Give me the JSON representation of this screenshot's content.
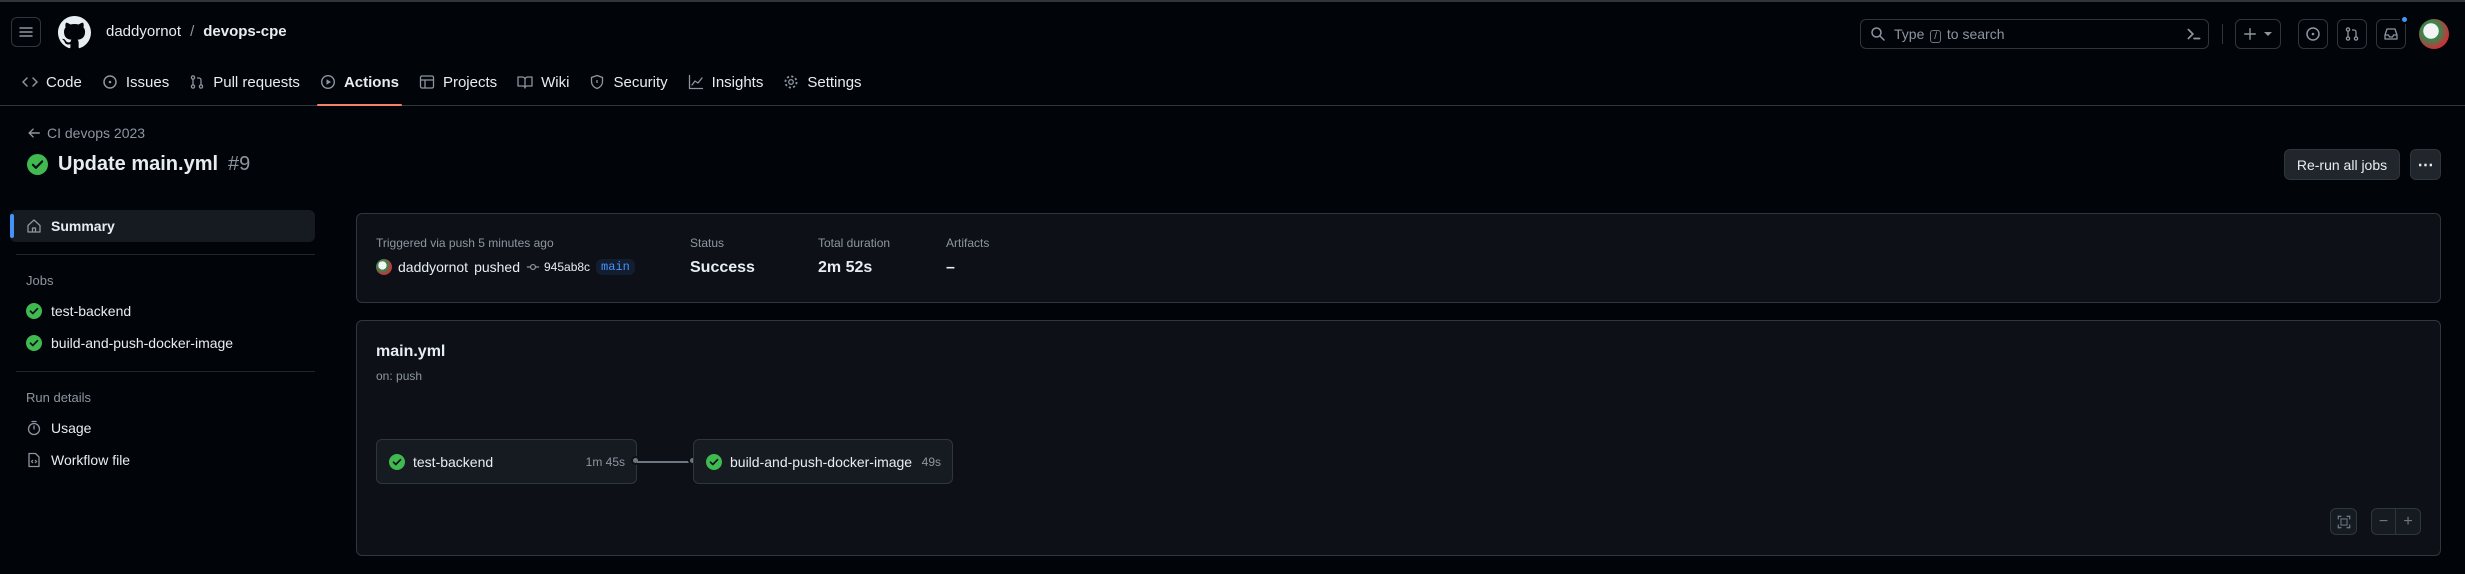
{
  "header": {
    "owner": "daddyornot",
    "separator": "/",
    "repo": "devops-cpe",
    "search_prefix": "Type",
    "search_key": "/",
    "search_suffix": "to search"
  },
  "repo_tabs": [
    {
      "label": "Code",
      "icon": "code-icon"
    },
    {
      "label": "Issues",
      "icon": "issue-icon"
    },
    {
      "label": "Pull requests",
      "icon": "pull-request-icon"
    },
    {
      "label": "Actions",
      "icon": "play-icon"
    },
    {
      "label": "Projects",
      "icon": "table-icon"
    },
    {
      "label": "Wiki",
      "icon": "book-icon"
    },
    {
      "label": "Security",
      "icon": "shield-icon"
    },
    {
      "label": "Insights",
      "icon": "graph-icon"
    },
    {
      "label": "Settings",
      "icon": "gear-icon"
    }
  ],
  "run": {
    "workflow_back": "CI devops 2023",
    "title": "Update main.yml",
    "number": "#9",
    "rerun_label": "Re-run all jobs",
    "more_label": "⋯"
  },
  "sidebar": {
    "summary_label": "Summary",
    "jobs_heading": "Jobs",
    "jobs": [
      "test-backend",
      "build-and-push-docker-image"
    ],
    "run_details_heading": "Run details",
    "usage_label": "Usage",
    "workflow_file_label": "Workflow file"
  },
  "summary": {
    "triggered_label": "Triggered via push 5 minutes ago",
    "actor": "daddyornot",
    "action": "pushed",
    "sha": "945ab8c",
    "branch": "main",
    "status_label": "Status",
    "status_value": "Success",
    "duration_label": "Total duration",
    "duration_value": "2m 52s",
    "artifacts_label": "Artifacts",
    "artifacts_value": "–"
  },
  "graph": {
    "file": "main.yml",
    "trigger": "on: push",
    "jobs": [
      {
        "name": "test-backend",
        "duration": "1m 45s"
      },
      {
        "name": "build-and-push-docker-image",
        "duration": "49s"
      }
    ],
    "zoom_out": "−",
    "zoom_in": "+"
  },
  "colors": {
    "success": "#3fb950",
    "accent": "#f78166",
    "link": "#4493f8"
  }
}
